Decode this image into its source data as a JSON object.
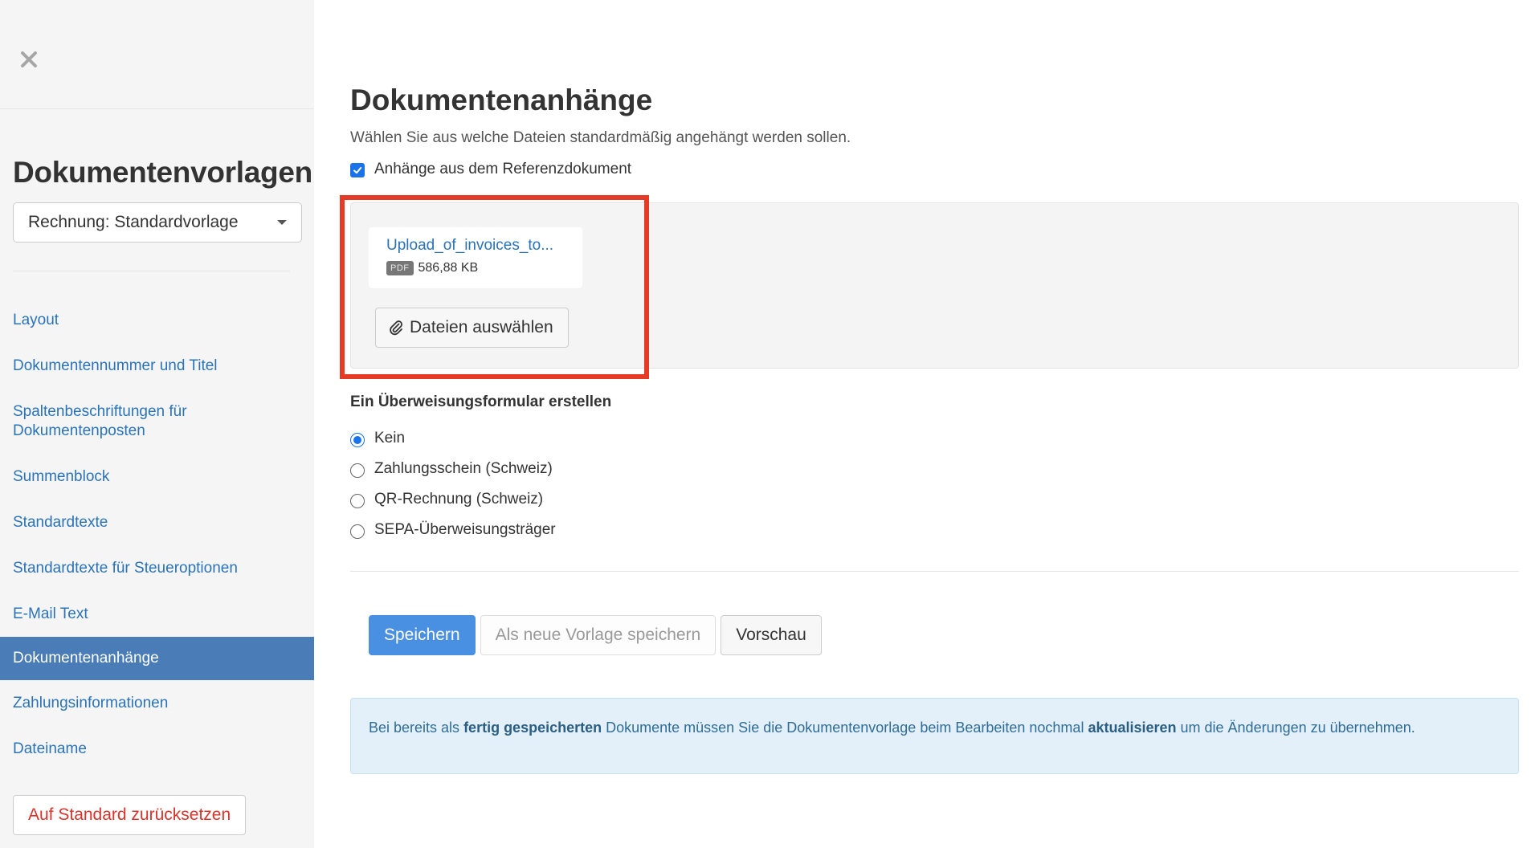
{
  "sidebar": {
    "title": "Dokumentenvorlagen",
    "template_select": "Rechnung: Standardvorlage",
    "nav_items": [
      {
        "label": "Layout"
      },
      {
        "label": "Dokumentennummer und Titel"
      },
      {
        "label": "Spaltenbeschriftungen für Dokumentenposten"
      },
      {
        "label": "Summenblock"
      },
      {
        "label": "Standardtexte"
      },
      {
        "label": "Standardtexte für Steueroptionen"
      },
      {
        "label": "E-Mail Text"
      },
      {
        "label": "Dokumentenanhänge",
        "active": true
      },
      {
        "label": "Zahlungsinformationen"
      },
      {
        "label": "Dateiname"
      }
    ],
    "reset_button": "Auf Standard zurücksetzen"
  },
  "main": {
    "title": "Dokumentenanhänge",
    "description": "Wählen Sie aus welche Dateien standardmäßig angehängt werden sollen.",
    "reference_checkbox": {
      "label": "Anhänge aus dem Referenzdokument",
      "checked": true
    },
    "attachments": {
      "file": {
        "name": "Upload_of_invoices_to...",
        "type_badge": "PDF",
        "size": "586,88 KB"
      },
      "choose_button": "Dateien auswählen"
    },
    "transfer_form": {
      "title": "Ein Überweisungsformular erstellen",
      "options": [
        {
          "label": "Kein",
          "checked": true
        },
        {
          "label": "Zahlungsschein (Schweiz)",
          "checked": false
        },
        {
          "label": "QR-Rechnung (Schweiz)",
          "checked": false
        },
        {
          "label": "SEPA-Überweisungsträger",
          "checked": false
        }
      ]
    },
    "buttons": {
      "save": "Speichern",
      "save_as_new": "Als neue Vorlage speichern",
      "preview": "Vorschau"
    },
    "info": {
      "part1": "Bei bereits als ",
      "bold1": "fertig gespeicherten",
      "part2": " Dokumente müssen Sie die Dokumentenvorlage beim Bearbeiten nochmal ",
      "bold2": "aktualisieren",
      "part3": " um die Änderungen zu übernehmen."
    }
  },
  "icons": {
    "close": "close-icon",
    "checkbox": "checkmark-icon",
    "paperclip": "paperclip-icon",
    "caret": "chevron-down-icon"
  },
  "colors": {
    "link": "#2a73b8",
    "active_nav": "#4a7db8",
    "primary_button": "#4a90e2",
    "highlight_frame": "#e43a26",
    "reset_text": "#d9342b",
    "info_bg": "#e3f0f9"
  }
}
